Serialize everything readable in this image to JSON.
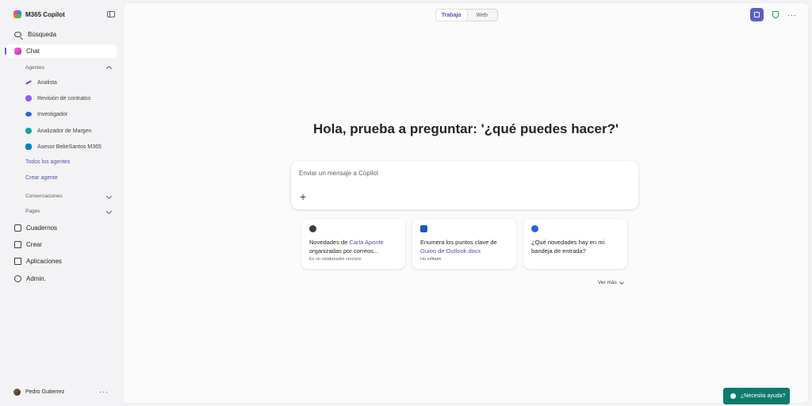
{
  "app": {
    "title": "M365 Copilot"
  },
  "nav": {
    "search": "Búsqueda",
    "chat": "Chat",
    "notebooks": "Cuadernos",
    "create": "Crear",
    "apps": "Aplicaciones",
    "admin": "Admin."
  },
  "agents": {
    "label": "Agentes",
    "items": [
      {
        "label": "Analista",
        "color": "#7c3aed"
      },
      {
        "label": "Revisión de contratos",
        "color": "#8b5cf6"
      },
      {
        "label": "Investigador",
        "color": "#2563eb"
      },
      {
        "label": "Analizador de Margen",
        "color": "#0ea5a4"
      },
      {
        "label": "Asesor BekeSantos M365",
        "color": "#0284c7"
      }
    ],
    "all_agents": "Todos los agentes",
    "create_agent": "Crear agente"
  },
  "sections": {
    "conversations": "Conversaciones",
    "pages": "Pages"
  },
  "user": {
    "name": "Pedro Gutierrez"
  },
  "mode_toggle": {
    "work": "Trabajo",
    "web": "Web"
  },
  "greeting": "Hola, prueba a preguntar: '¿qué puedes hacer?'",
  "composer": {
    "placeholder": "Enviar un mensaje a Copilot"
  },
  "suggestions": [
    {
      "pre": "Novedades de ",
      "highlight": "Carla Aponte",
      "post": " organizadas por correos...",
      "sub": "Es un colaborador cercano",
      "icon_color": "#3b3b3b"
    },
    {
      "pre": "Enumera los puntos clave de ",
      "highlight": "Guion de Outlook.docx",
      "post": "",
      "sub": "Ha editado",
      "icon_color": "#185abd"
    },
    {
      "pre": "¿Qué novedades hay en mi bandeja de entrada?",
      "highlight": "",
      "post": "",
      "sub": "",
      "icon_color": "#2563eb"
    }
  ],
  "see_more": "Ver más",
  "help": "¿Necesita ayuda?",
  "colors": {
    "accent": "#5b5fc7",
    "help_bg": "#0f7b6c",
    "link": "#4f52b2"
  }
}
